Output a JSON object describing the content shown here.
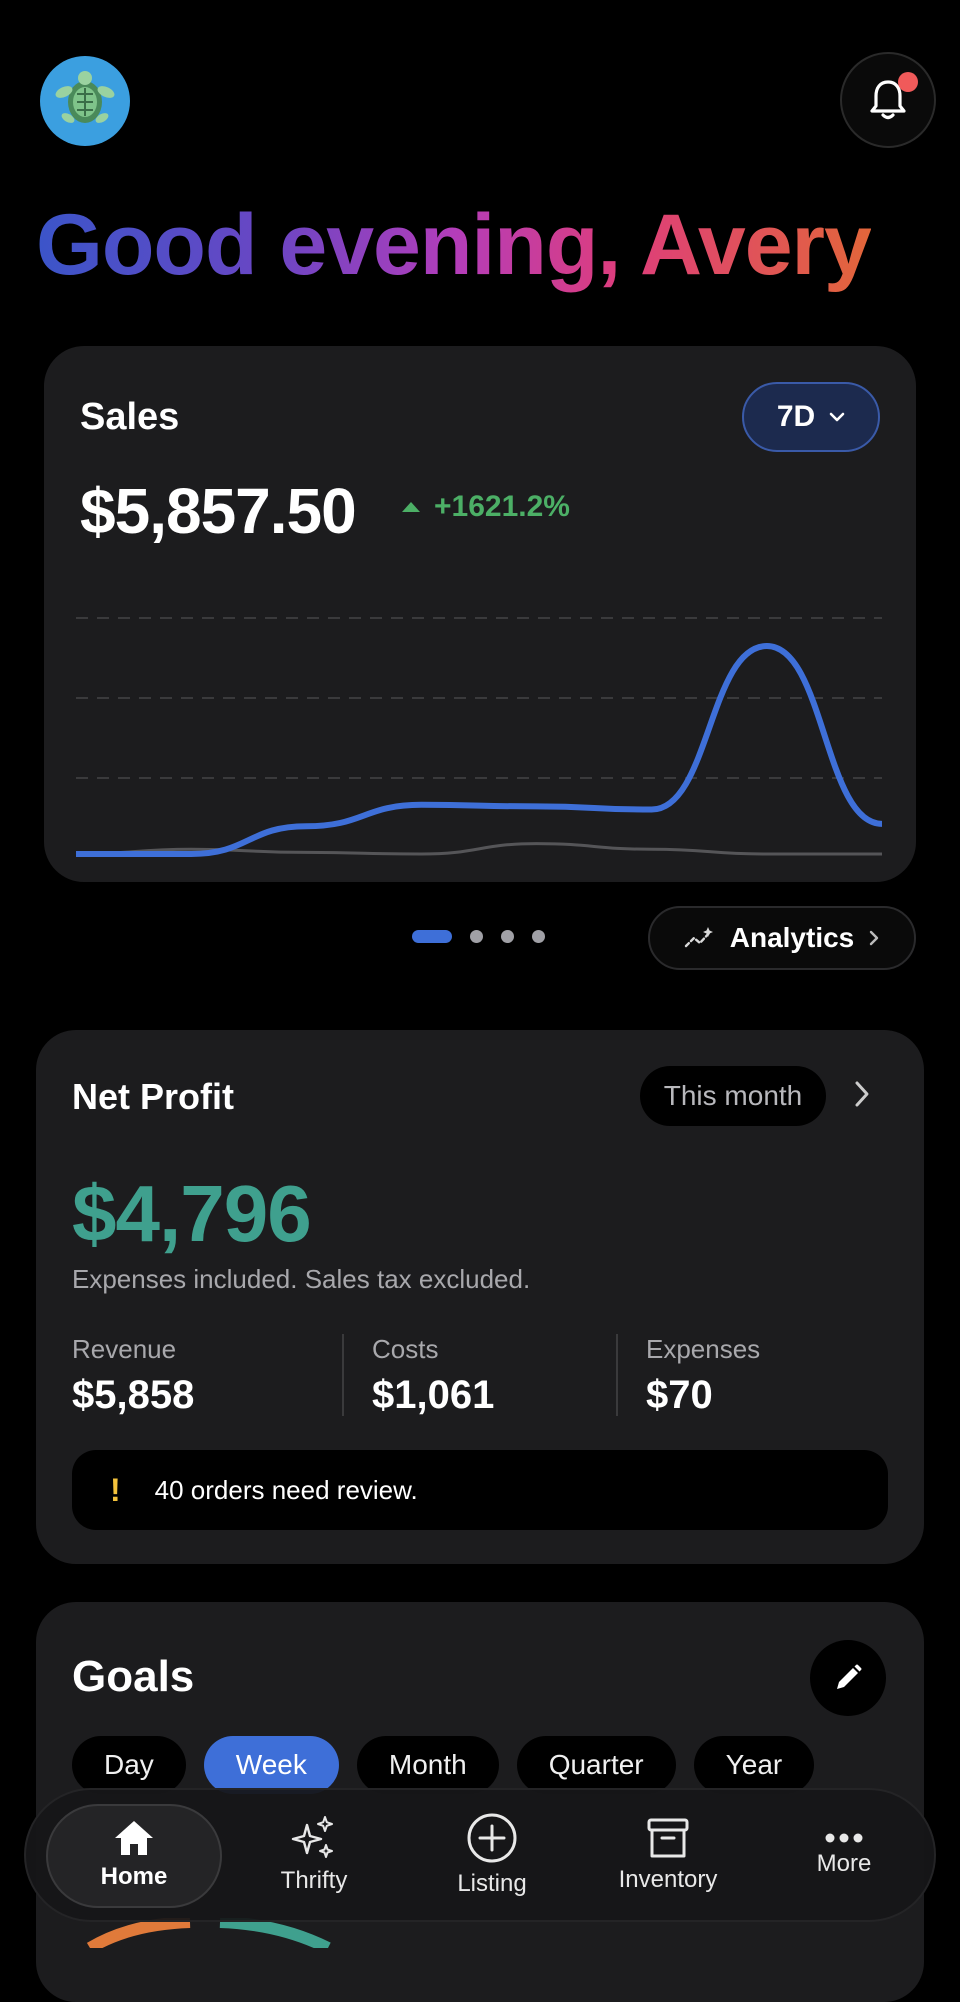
{
  "header": {
    "greeting": "Good evening, Avery",
    "avatar_icon": "turtle-avatar-icon",
    "notification_icon": "bell-icon",
    "has_unread_notifications": true
  },
  "sales": {
    "title": "Sales",
    "range_label": "7D",
    "amount": "$5,857.50",
    "change": "+1621.2%",
    "change_color": "#4caf66",
    "pager": {
      "total": 4,
      "active": 0
    },
    "analytics_label": "Analytics"
  },
  "chart_data": {
    "type": "line",
    "title": "",
    "xlabel": "",
    "ylabel": "",
    "grid": "horizontal dashed",
    "series": [
      {
        "values": [
          0,
          0,
          350,
          620,
          600,
          560,
          2620,
          380
        ],
        "color": "#3e6fd8"
      },
      {
        "values": [
          0,
          60,
          20,
          0,
          130,
          60,
          0,
          0
        ],
        "color": "#555558"
      }
    ],
    "ylim": [
      0,
      3200
    ]
  },
  "net_profit": {
    "title": "Net Profit",
    "period": "This month",
    "amount": "$4,796",
    "amount_color": "#3fa08e",
    "note": "Expenses included. Sales tax excluded.",
    "stats": [
      {
        "label": "Revenue",
        "value": "$5,858"
      },
      {
        "label": "Costs",
        "value": "$1,061"
      },
      {
        "label": "Expenses",
        "value": "$70"
      }
    ],
    "review_notice": "40 orders need review."
  },
  "goals": {
    "title": "Goals",
    "tabs": [
      "Day",
      "Week",
      "Month",
      "Quarter",
      "Year"
    ],
    "active_tab": "Week"
  },
  "nav": {
    "items": [
      {
        "label": "Home",
        "icon": "home-icon"
      },
      {
        "label": "Thrifty",
        "icon": "sparkles-icon"
      },
      {
        "label": "Listing",
        "icon": "plus-circle-icon"
      },
      {
        "label": "Inventory",
        "icon": "archive-box-icon"
      },
      {
        "label": "More",
        "icon": "more-dots-icon"
      }
    ],
    "active": "Home"
  }
}
